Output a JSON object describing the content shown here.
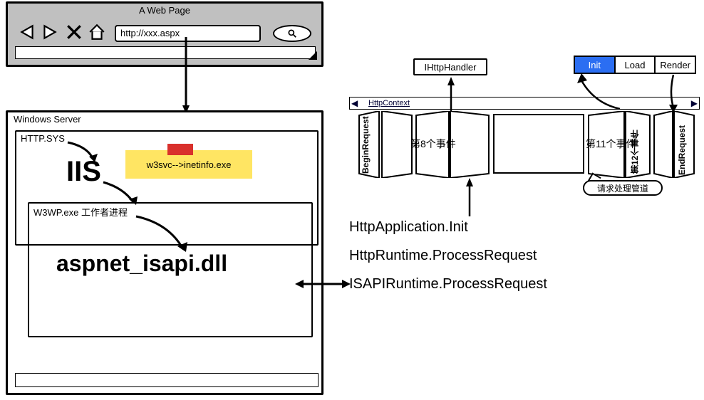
{
  "browser": {
    "title": "A Web Page",
    "url": "http://xxx.aspx"
  },
  "server": {
    "title": "Windows Server",
    "httpsys": "HTTP.SYS",
    "iis": "IIS",
    "note": "w3svc-->inetinfo.exe",
    "w3wp": "W3WP.exe 工作者进程",
    "dll": "aspnet_isapi.dll"
  },
  "right": {
    "handler": "IHttpHandler",
    "lifecycle": {
      "init": "Init",
      "load": "Load",
      "render": "Render"
    },
    "httpcontext": "HttpContext",
    "begin": "BeginRequest",
    "end": "EndRequest",
    "event8": "第8个事件",
    "event11": "第11个事件",
    "event12": "第12个事件",
    "pipeline_callout": "请求处理管道",
    "api1": "HttpApplication.Init",
    "api2": "HttpRuntime.ProcessRequest",
    "api3": "ISAPIRuntime.ProcessRequest"
  }
}
